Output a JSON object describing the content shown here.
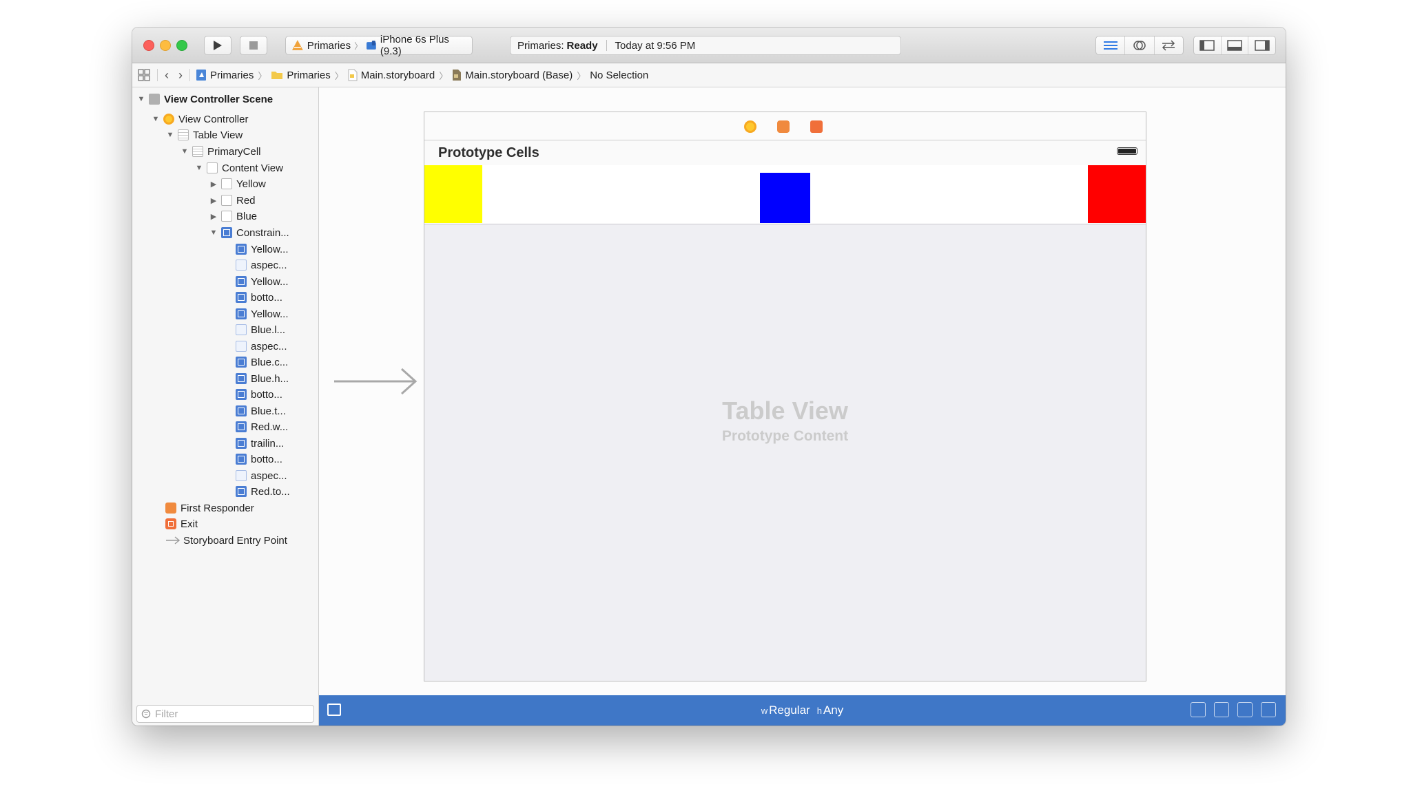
{
  "toolbar": {
    "scheme_name": "Primaries",
    "scheme_sep": "〉",
    "device": "iPhone 6s Plus (9.3)",
    "status_project": "Primaries:",
    "status_state": "Ready",
    "status_time": "Today at 9:56 PM"
  },
  "jumpbar": {
    "crumbs": [
      "Primaries",
      "Primaries",
      "Main.storyboard",
      "Main.storyboard (Base)",
      "No Selection"
    ],
    "sep": "〉"
  },
  "navigator": {
    "items": [
      {
        "label": "View Controller Scene",
        "disclosure": "▼"
      },
      {
        "label": "View Controller",
        "disclosure": "▼"
      },
      {
        "label": "Table View",
        "disclosure": "▼"
      },
      {
        "label": "PrimaryCell",
        "disclosure": "▼"
      },
      {
        "label": "Content View",
        "disclosure": "▼"
      },
      {
        "label": "Yellow",
        "disclosure": "▶"
      },
      {
        "label": "Red",
        "disclosure": "▶"
      },
      {
        "label": "Blue",
        "disclosure": "▶"
      },
      {
        "label": "Constrain...",
        "disclosure": "▼"
      },
      {
        "label": "Yellow..."
      },
      {
        "label": "aspec..."
      },
      {
        "label": "Yellow..."
      },
      {
        "label": "botto..."
      },
      {
        "label": "Yellow..."
      },
      {
        "label": "Blue.l..."
      },
      {
        "label": "aspec..."
      },
      {
        "label": "Blue.c..."
      },
      {
        "label": "Blue.h..."
      },
      {
        "label": "botto..."
      },
      {
        "label": "Blue.t..."
      },
      {
        "label": "Red.w..."
      },
      {
        "label": "trailin..."
      },
      {
        "label": "botto..."
      },
      {
        "label": "aspec..."
      },
      {
        "label": "Red.to..."
      },
      {
        "label": "First Responder"
      },
      {
        "label": "Exit"
      },
      {
        "label": "Storyboard Entry Point"
      }
    ],
    "filter_placeholder": "Filter"
  },
  "canvas": {
    "prototype_header": "Prototype Cells",
    "table_view_title": "Table View",
    "table_view_subtitle": "Prototype Content",
    "swatch_colors": {
      "yellow": "#ffff00",
      "blue": "#0000ff",
      "red": "#ff0000"
    }
  },
  "sizebar": {
    "w_prefix": "w",
    "w_value": "Regular",
    "h_prefix": "h",
    "h_value": "Any"
  },
  "colors": {
    "accent": "#3f77c7",
    "close": "#fc605b",
    "minimize": "#fdbc40",
    "zoom": "#34c84a"
  }
}
